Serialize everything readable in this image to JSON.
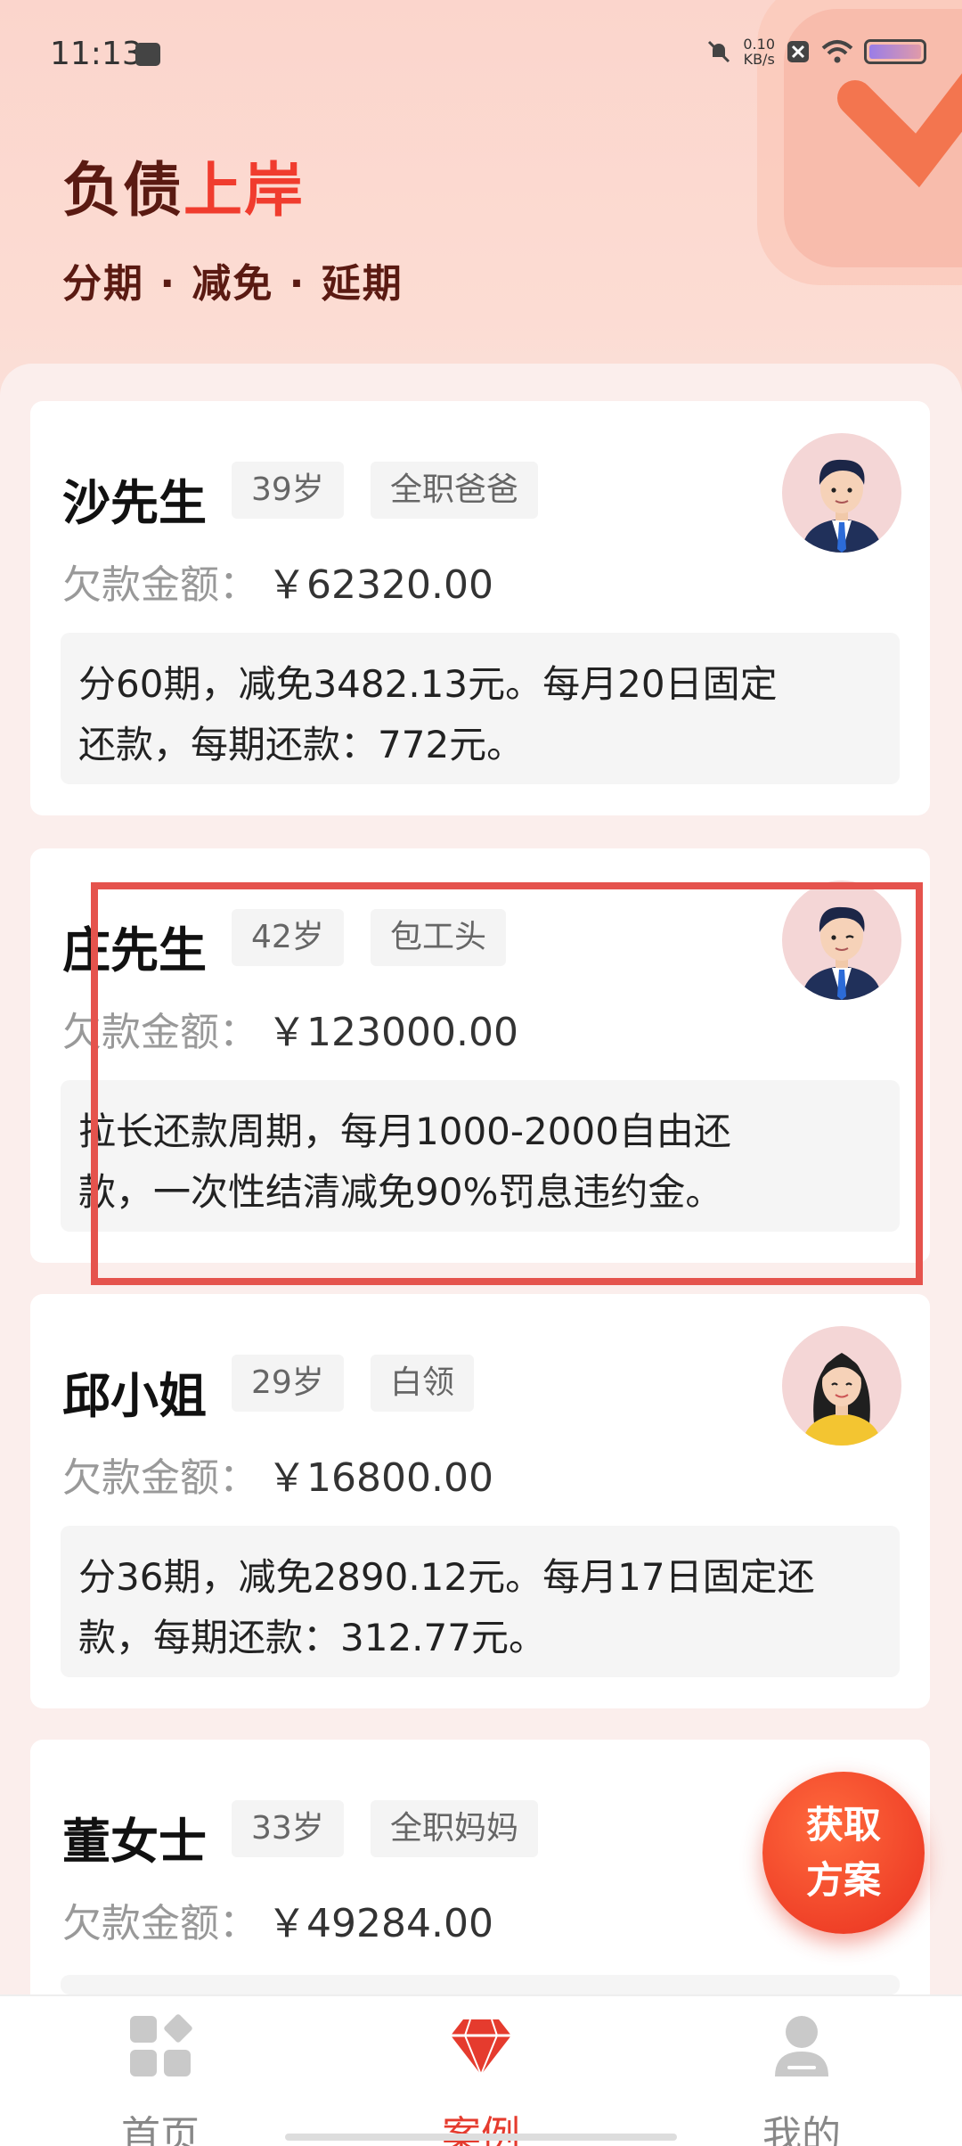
{
  "status_bar": {
    "time": "11:13",
    "speed_value": "0.10",
    "speed_unit": "KB/s"
  },
  "header": {
    "title_part1": "负债",
    "title_part2": "上岸",
    "subtitle": "分期 · 减免 · 延期"
  },
  "cases": [
    {
      "name": "沙先生",
      "age": "39岁",
      "role": "全职爸爸",
      "debt_label": "欠款金额：",
      "debt_amount": "￥62320.00",
      "plan_line1": "分60期，减免3482.13元。每月20日固定",
      "plan_line2": "还款，每期还款：772元。",
      "avatar": "male-avatar-icon"
    },
    {
      "name": "庄先生",
      "age": "42岁",
      "role": "包工头",
      "debt_label": "欠款金额：",
      "debt_amount": "￥123000.00",
      "plan_line1": "拉长还款周期，每月1000-2000自由还",
      "plan_line2": "款，一次性结清减免90%罚息违约金。",
      "avatar": "male-avatar-icon"
    },
    {
      "name": "邱小姐",
      "age": "29岁",
      "role": "白领",
      "debt_label": "欠款金额：",
      "debt_amount": "￥16800.00",
      "plan_line1": "分36期，减免2890.12元。每月17日固定还",
      "plan_line2": "款，每期还款：312.77元。",
      "avatar": "female-avatar-icon"
    },
    {
      "name": "董女士",
      "age": "33岁",
      "role": "全职妈妈",
      "debt_label": "欠款金额：",
      "debt_amount": "￥49284.00",
      "plan_line1": "",
      "plan_line2": "",
      "avatar": ""
    }
  ],
  "fab": {
    "line1": "获取",
    "line2": "方案"
  },
  "tabs": [
    {
      "label": "首页",
      "icon": "home-grid-icon"
    },
    {
      "label": "案例",
      "icon": "diamond-icon",
      "active": true
    },
    {
      "label": "我的",
      "icon": "person-icon"
    }
  ],
  "colors": {
    "accent": "#e53b2e",
    "title_dark": "#5a1a12",
    "highlight_box": "#e5534d"
  }
}
